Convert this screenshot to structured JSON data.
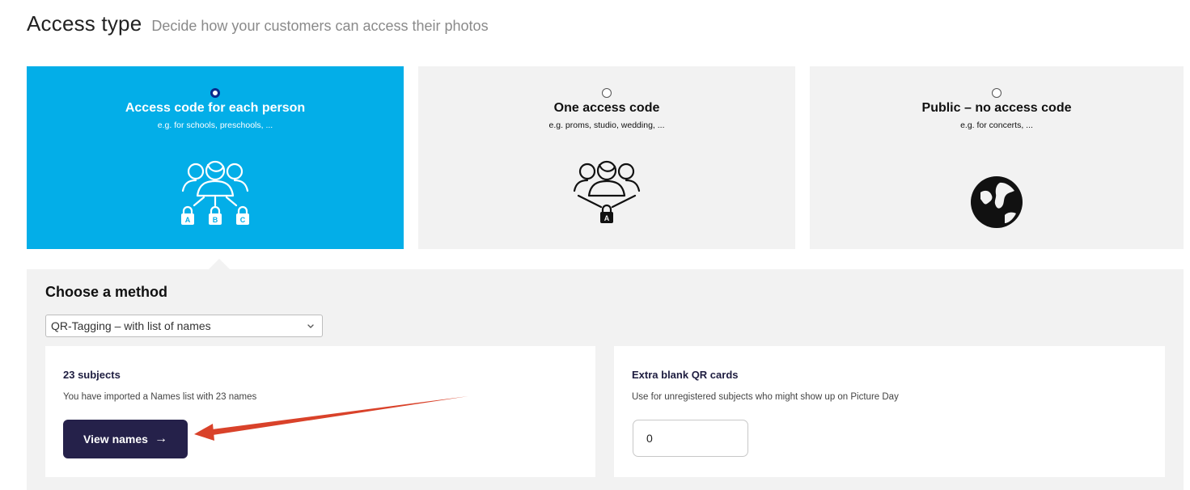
{
  "header": {
    "title": "Access type",
    "subtitle": "Decide how your customers can access their photos"
  },
  "access_options": [
    {
      "label": "Access code for each person",
      "sub": "e.g. for schools, preschools, ...",
      "selected": true,
      "icon": "group-individual-locks-icon"
    },
    {
      "label": "One access code",
      "sub": "e.g. proms, studio, wedding, ...",
      "selected": false,
      "icon": "group-single-lock-icon"
    },
    {
      "label": "Public – no access code",
      "sub": "e.g. for concerts, ...",
      "selected": false,
      "icon": "globe-icon"
    }
  ],
  "lock_letters": [
    "A",
    "B",
    "C"
  ],
  "single_lock_letter": "A",
  "method": {
    "title": "Choose a method",
    "selected_value": "QR-Tagging – with list of names"
  },
  "subjects": {
    "title": "23 subjects",
    "description": "You have imported a Names list with 23 names",
    "button_label": "View names",
    "button_arrow": "→"
  },
  "extra_cards": {
    "title": "Extra blank QR cards",
    "description": "Use for unregistered subjects who might show up on Picture Day",
    "value": "0"
  },
  "colors": {
    "selected_card": "#03aee8",
    "card_bg": "#f2f2f2",
    "button_bg": "#25214a",
    "annotation_arrow": "#d9422a"
  }
}
